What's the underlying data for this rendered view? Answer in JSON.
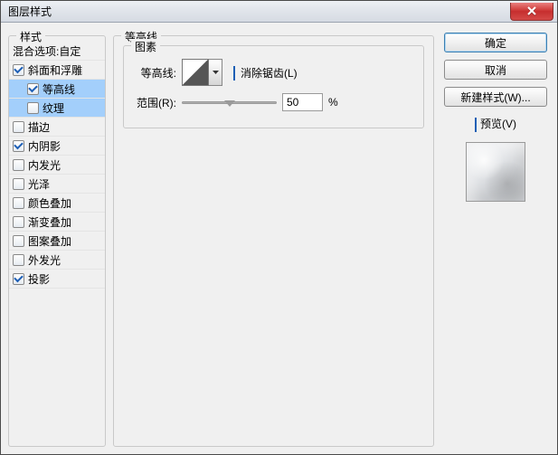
{
  "window": {
    "title": "图层样式"
  },
  "styles_panel": {
    "legend": "样式",
    "blend_options": "混合选项:自定",
    "items": [
      {
        "label": "斜面和浮雕",
        "checked": true,
        "selected": false,
        "sub": false
      },
      {
        "label": "等高线",
        "checked": true,
        "selected": true,
        "sub": true
      },
      {
        "label": "纹理",
        "checked": false,
        "selected": true,
        "sub": true
      },
      {
        "label": "描边",
        "checked": false,
        "selected": false,
        "sub": false
      },
      {
        "label": "内阴影",
        "checked": true,
        "selected": false,
        "sub": false
      },
      {
        "label": "内发光",
        "checked": false,
        "selected": false,
        "sub": false
      },
      {
        "label": "光泽",
        "checked": false,
        "selected": false,
        "sub": false
      },
      {
        "label": "颜色叠加",
        "checked": false,
        "selected": false,
        "sub": false
      },
      {
        "label": "渐变叠加",
        "checked": false,
        "selected": false,
        "sub": false
      },
      {
        "label": "图案叠加",
        "checked": false,
        "selected": false,
        "sub": false
      },
      {
        "label": "外发光",
        "checked": false,
        "selected": false,
        "sub": false
      },
      {
        "label": "投影",
        "checked": true,
        "selected": false,
        "sub": false
      }
    ]
  },
  "settings": {
    "legend": "等高线",
    "group_legend": "图素",
    "contour_label": "等高线:",
    "antialias_label": "消除锯齿(L)",
    "antialias_checked": true,
    "range_label": "范围(R):",
    "range_value": "50",
    "range_unit": "%"
  },
  "buttons": {
    "ok": "确定",
    "cancel": "取消",
    "new_style": "新建样式(W)...",
    "preview_label": "预览(V)",
    "preview_checked": true
  }
}
